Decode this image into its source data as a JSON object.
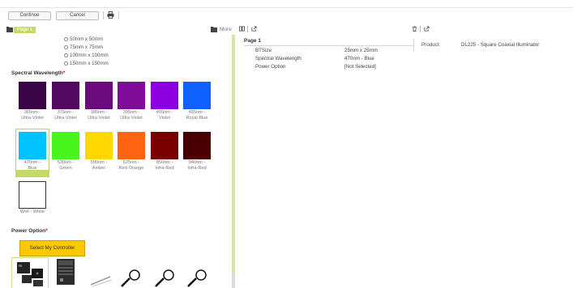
{
  "toolbar": {
    "continue_label": "Continue",
    "cancel_label": "Cancel",
    "print_icon": "printer-icon"
  },
  "left_panel": {
    "page_tab": "Page 1",
    "more_label": "More",
    "size_options": [
      "50mm x 50mm",
      "75mm x 75mm",
      "100mm x 100mm",
      "150mm x 150mm"
    ],
    "spectral_title": "Spectral Wavelength",
    "required_mark": "*",
    "swatches": [
      {
        "line1": "365nm -",
        "line2": "Ultra-Violet",
        "color": "#3a0648"
      },
      {
        "line1": "375nm -",
        "line2": "Ultra-Violet",
        "color": "#52085e"
      },
      {
        "line1": "385nm -",
        "line2": "Ultra-Violet",
        "color": "#6b0a7c"
      },
      {
        "line1": "395nm -",
        "line2": "Ultra-Violet",
        "color": "#7f0b98"
      },
      {
        "line1": "405nm -",
        "line2": "Violet",
        "color": "#8c00e0"
      },
      {
        "line1": "455nm -",
        "line2": "Royal Blue",
        "color": "#0f62ff"
      },
      {
        "line1": "470nm -",
        "line2": "Blue",
        "color": "#00c2ff"
      },
      {
        "line1": "530nm -",
        "line2": "Green",
        "color": "#48f51e"
      },
      {
        "line1": "590nm -",
        "line2": "Amber",
        "color": "#ffd800"
      },
      {
        "line1": "625nm -",
        "line2": "Red Orange",
        "color": "#ff6410"
      },
      {
        "line1": "850nm -",
        "line2": "Infra-Red",
        "color": "#7a0000"
      },
      {
        "line1": "940nm -",
        "line2": "Infra-Red",
        "color": "#4a0000"
      },
      {
        "line1": "WHI - White",
        "line2": "",
        "color": "#ffffff"
      }
    ],
    "selected_swatch": "470nm - Blue",
    "power_title": "Power Option",
    "controller_button": "Select My Controller"
  },
  "summary": {
    "title": "Page 1",
    "rows": [
      {
        "key": "BTSize",
        "value": "25mm x 25mm"
      },
      {
        "key": "Spectral Wavelength",
        "value": "470nm - Blue"
      },
      {
        "key": "Power Option",
        "value": "[Not Selected]"
      }
    ],
    "product_key": "Product:",
    "product_value": "DL225 - Square Coaxial Illuminator"
  },
  "colors": {
    "accent": "#c5d96a",
    "controller_button": "#fcc800",
    "required": "#dd0000"
  }
}
